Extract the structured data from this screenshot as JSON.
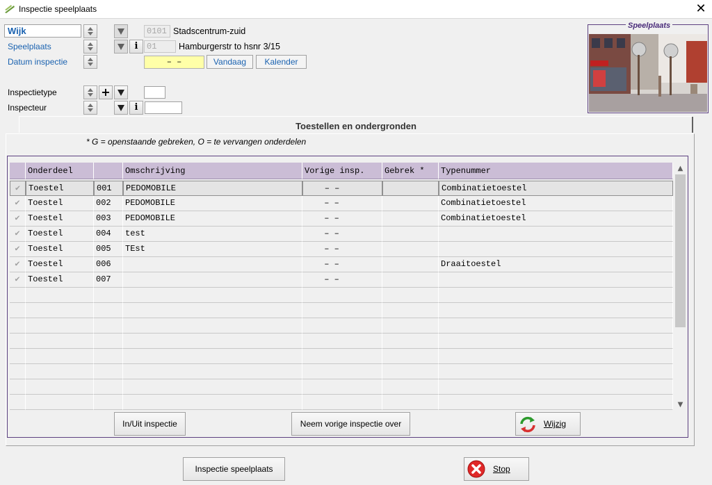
{
  "window": {
    "title": "Inspectie speelplaats",
    "close_glyph": "✕"
  },
  "form": {
    "wijk_label": "Wijk",
    "wijk_code": "0101",
    "wijk_name": "Stadscentrum-zuid",
    "speelplaats_label": "Speelplaats",
    "speelplaats_code": "01",
    "speelplaats_name": "Hamburgerstr to hsnr 3/15",
    "datum_label": "Datum inspectie",
    "datum_value": "–  –",
    "vandaag_label": "Vandaag",
    "kalender_label": "Kalender",
    "inspectietype_label": "Inspectietype",
    "inspecteur_label": "Inspecteur",
    "plus_glyph": "+",
    "info_glyph": "i"
  },
  "photo": {
    "label": "Speelplaats"
  },
  "tab": {
    "title": "Toestellen en ondergronden",
    "note": "* G = openstaande gebreken, O = te vervangen onderdelen"
  },
  "grid": {
    "columns": [
      "",
      "Onderdeel",
      "",
      "Omschrijving",
      "Vorige insp.",
      "Gebrek *",
      "Typenummer"
    ],
    "rows": [
      {
        "check": "✔",
        "onderdeel": "Toestel",
        "nr": "001",
        "omschrijving": "PEDOMOBILE",
        "vorige": "–  –",
        "gebrek": "",
        "type": "Combinatietoestel"
      },
      {
        "check": "✔",
        "onderdeel": "Toestel",
        "nr": "002",
        "omschrijving": "PEDOMOBILE",
        "vorige": "–  –",
        "gebrek": "",
        "type": "Combinatietoestel"
      },
      {
        "check": "✔",
        "onderdeel": "Toestel",
        "nr": "003",
        "omschrijving": "PEDOMOBILE",
        "vorige": "–  –",
        "gebrek": "",
        "type": "Combinatietoestel"
      },
      {
        "check": "✔",
        "onderdeel": "Toestel",
        "nr": "004",
        "omschrijving": "test",
        "vorige": "–  –",
        "gebrek": "",
        "type": ""
      },
      {
        "check": "✔",
        "onderdeel": "Toestel",
        "nr": "005",
        "omschrijving": "TEst",
        "vorige": "–  –",
        "gebrek": "",
        "type": ""
      },
      {
        "check": "✔",
        "onderdeel": "Toestel",
        "nr": "006",
        "omschrijving": "",
        "vorige": "–  –",
        "gebrek": "",
        "type": "Draaitoestel"
      },
      {
        "check": "✔",
        "onderdeel": "Toestel",
        "nr": "007",
        "omschrijving": "",
        "vorige": "–  –",
        "gebrek": "",
        "type": ""
      }
    ],
    "scroll_up": "▲",
    "scroll_down": "▼"
  },
  "buttons": {
    "inuit": "In/Uit inspectie",
    "neem": "Neem vorige inspectie over",
    "wijzig": "Wijzig",
    "inspectie_speelplaats": "Inspectie speelplaats",
    "stop": "Stop"
  },
  "colors": {
    "accent": "#1a62b0",
    "header": "#cbbdd6",
    "frame": "#5c4080",
    "date_bg": "#ffffa8"
  }
}
